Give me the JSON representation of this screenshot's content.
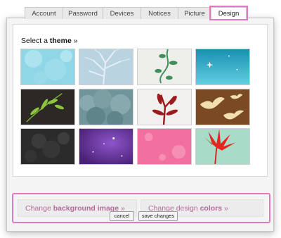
{
  "tabs": [
    {
      "label": "Account"
    },
    {
      "label": "Password"
    },
    {
      "label": "Devices"
    },
    {
      "label": "Notices"
    },
    {
      "label": "Picture"
    },
    {
      "label": "Design",
      "active": true
    }
  ],
  "theme_section": {
    "prefix": "Select a ",
    "keyword": "theme",
    "suffix": " »"
  },
  "themes": [
    {
      "name": "light-blue-bokeh"
    },
    {
      "name": "blue-tree-branches"
    },
    {
      "name": "green-vine"
    },
    {
      "name": "teal-sparkle"
    },
    {
      "name": "green-leaves-on-dark"
    },
    {
      "name": "teal-trees-silhouette"
    },
    {
      "name": "red-plant-on-white"
    },
    {
      "name": "cream-birds-on-brown"
    },
    {
      "name": "dark-grey-foliage"
    },
    {
      "name": "purple-stars"
    },
    {
      "name": "pink-flowers"
    },
    {
      "name": "red-leaf-on-mint"
    }
  ],
  "links": {
    "background": {
      "prefix": "Change ",
      "bold": "background image",
      "suffix": " »"
    },
    "colors": {
      "prefix": "Change design ",
      "bold": "colors",
      "suffix": " »"
    }
  },
  "buttons": {
    "cancel": "cancel",
    "save": "save changes"
  },
  "colors": {
    "highlight": "#e27ac1",
    "link": "#b66a9a"
  }
}
